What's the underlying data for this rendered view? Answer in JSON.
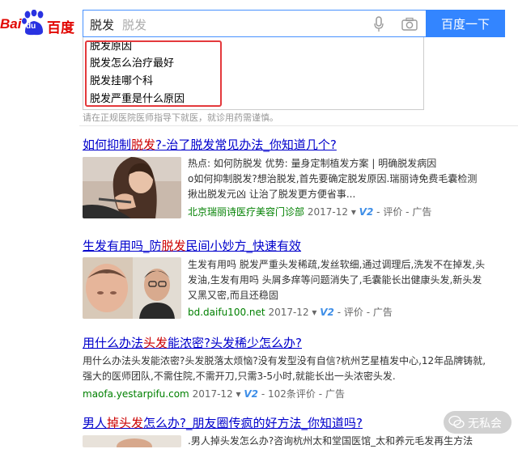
{
  "logo": {
    "part1": "Bai",
    "du": "du",
    "part2": "百度"
  },
  "search": {
    "query": "脱发",
    "hint": "脱发",
    "button": "百度一下"
  },
  "suggestions": [
    "脱发原因",
    "脱发怎么治疗最好",
    "脱发挂哪个科",
    "脱发严重是什么原因"
  ],
  "notice": "请在正规医院医师指导下就医，就诊用药需谨慎。",
  "results": [
    {
      "title_parts": [
        "如何抑制",
        "脱发",
        "?-治了脱发常见办法_你知道几个?"
      ],
      "lines": [
        "热点: 如何防脱发   优势: 量身定制植发方案 | 明确脱发病因",
        "o如何抑制脱发?想治脱发,首先要确定脱发原因.瑞丽诗免费毛囊检测",
        "揪出脱发元凶 让治了脱发更方便省事..."
      ],
      "source": "北京瑞丽诗医疗美容门诊部",
      "date": "2017-12",
      "v": "V2",
      "review": "评价",
      "ad": "广告"
    },
    {
      "title_parts": [
        "生发有用吗_防",
        "脱发",
        "民间小妙方_快速有效"
      ],
      "lines": [
        "生发有用吗 脱发严重头发稀疏,发丝软细,通过调理后,洗发不在掉发,头",
        "发油,生发有用吗 头屑多痒等问题消失了,毛囊能长出健康头发,新头发",
        "又黑又密,而且还稳固"
      ],
      "source": "bd.daifu100.net",
      "date": "2017-12",
      "v": "V2",
      "review": "评价",
      "ad": "广告"
    },
    {
      "title_parts": [
        "用什么办法",
        "头发",
        "能浓密?头发稀少怎么办?"
      ],
      "lines": [
        "用什么办法头发能浓密?头发脱落太烦恼?没有发型没有自信?杭州艺星植发中心,12年品牌铸就,",
        "强大的医师团队,不需住院,不需开刀,只需3-5小时,就能长出一头浓密头发."
      ],
      "source": "maofa.yestarpifu.com",
      "date": "2017-12",
      "v": "V2",
      "review": "102条评价",
      "ad": "广告"
    },
    {
      "title_parts": [
        "男人",
        "掉头发",
        "怎么办?_朋友圈传疯的好方法_你知道吗?"
      ],
      "lines": [
        ".男人掉头发怎么办?咨询杭州太和堂国医馆_太和养元毛发再生方法"
      ]
    }
  ],
  "watermark": "无私会",
  "colors": {
    "link": "#0000cc",
    "red": "#c00",
    "green": "#008000",
    "brand": "#3385ff",
    "logo_red": "#e10601"
  }
}
